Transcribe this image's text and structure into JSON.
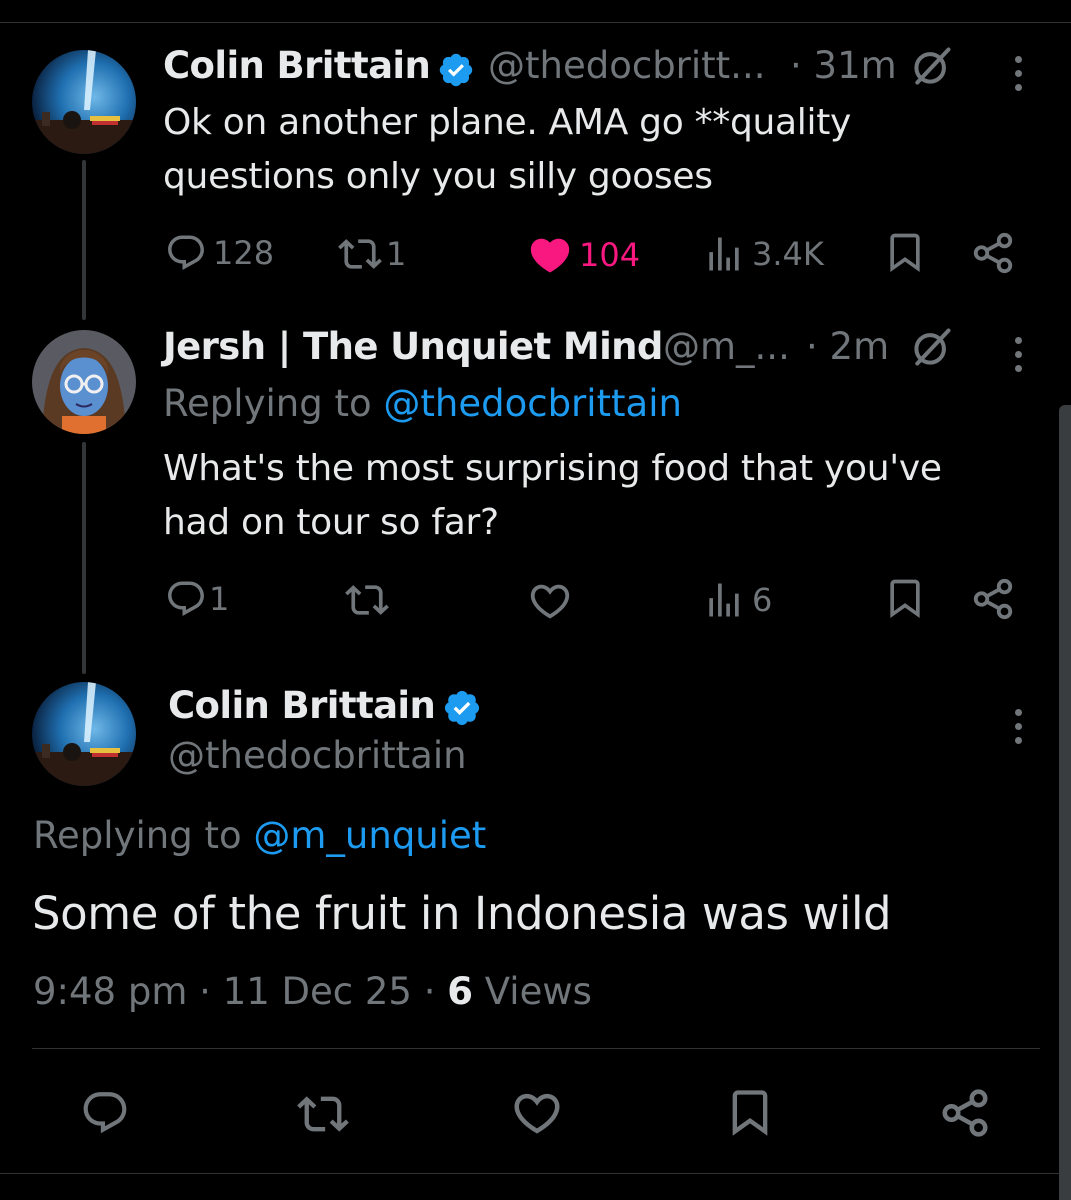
{
  "colors": {
    "background": "#000000",
    "text": "#e7e9ea",
    "muted": "#71767b",
    "link": "#1d9bf0",
    "like": "#f91880",
    "verified": "#1d9bf0"
  },
  "tweets": [
    {
      "author": "Colin Brittain",
      "handle": "@thedocbritt...",
      "time": "· 31m",
      "verified": true,
      "text_lines": [
        "Ok on another plane. AMA go **quality",
        "questions only you silly gooses"
      ],
      "replies": "128",
      "retweets": "1",
      "likes": "104",
      "liked": true,
      "views": "3.4K",
      "icons": [
        "grok-icon",
        "more-icon",
        "reply-icon",
        "retweet-icon",
        "heart-filled-icon",
        "views-icon",
        "bookmark-icon",
        "share-icon"
      ]
    },
    {
      "author": "Jersh | The Unquiet Mind",
      "handle": "@m_...",
      "time": "· 2m",
      "verified": false,
      "replying_prefix": "Replying to",
      "replying_to": "@thedocbrittain",
      "text_lines": [
        "What's the most surprising food that you've",
        "had on tour so far?"
      ],
      "replies": "1",
      "retweets": "",
      "likes": "",
      "views": "6",
      "icons": [
        "grok-icon",
        "more-icon",
        "reply-icon",
        "retweet-icon",
        "heart-icon",
        "views-icon",
        "bookmark-icon",
        "share-icon"
      ]
    }
  ],
  "main": {
    "author": "Colin Brittain",
    "handle": "@thedocbrittain",
    "verified": true,
    "replying_prefix": "Replying to",
    "replying_to": "@m_unquiet",
    "text": "Some of the fruit in Indonesia was wild",
    "time": "9:48 pm",
    "date": "11 Dec 25",
    "views_count": "6",
    "views_label": "Views",
    "icons": [
      "reply-icon",
      "retweet-icon",
      "heart-icon",
      "bookmark-icon",
      "share-icon",
      "more-icon"
    ]
  }
}
